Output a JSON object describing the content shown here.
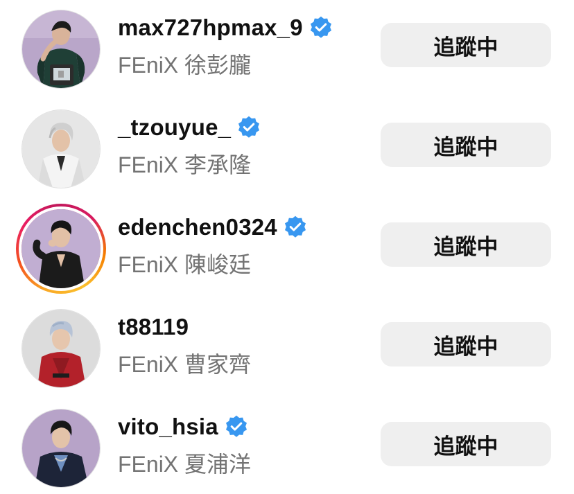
{
  "users": [
    {
      "username": "max727hpmax_9",
      "subtitle": "FEniX 徐彭朧",
      "verified": true,
      "has_story": false,
      "button": "追蹤中",
      "avatar_bg": "#b9a6c9"
    },
    {
      "username": "_tzouyue_",
      "subtitle": "FEniX 李承隆",
      "verified": true,
      "has_story": false,
      "button": "追蹤中",
      "avatar_bg": "#e6e6e6"
    },
    {
      "username": "edenchen0324",
      "subtitle": "FEniX 陳峻廷",
      "verified": true,
      "has_story": true,
      "button": "追蹤中",
      "avatar_bg": "#c1aed2"
    },
    {
      "username": "t88119",
      "subtitle": "FEniX 曹家齊",
      "verified": false,
      "has_story": false,
      "button": "追蹤中",
      "avatar_bg": "#dcdcdc"
    },
    {
      "username": "vito_hsia",
      "subtitle": "FEniX 夏浦洋",
      "verified": true,
      "has_story": false,
      "button": "追蹤中",
      "avatar_bg": "#b7a3c8"
    }
  ],
  "colors": {
    "verified_badge": "#3897f0",
    "button_bg": "#efefef",
    "subtitle_text": "#737373",
    "story_ring": [
      "#f9a825",
      "#e91e63"
    ]
  },
  "icons": {
    "verified": "verified-badge-icon"
  }
}
